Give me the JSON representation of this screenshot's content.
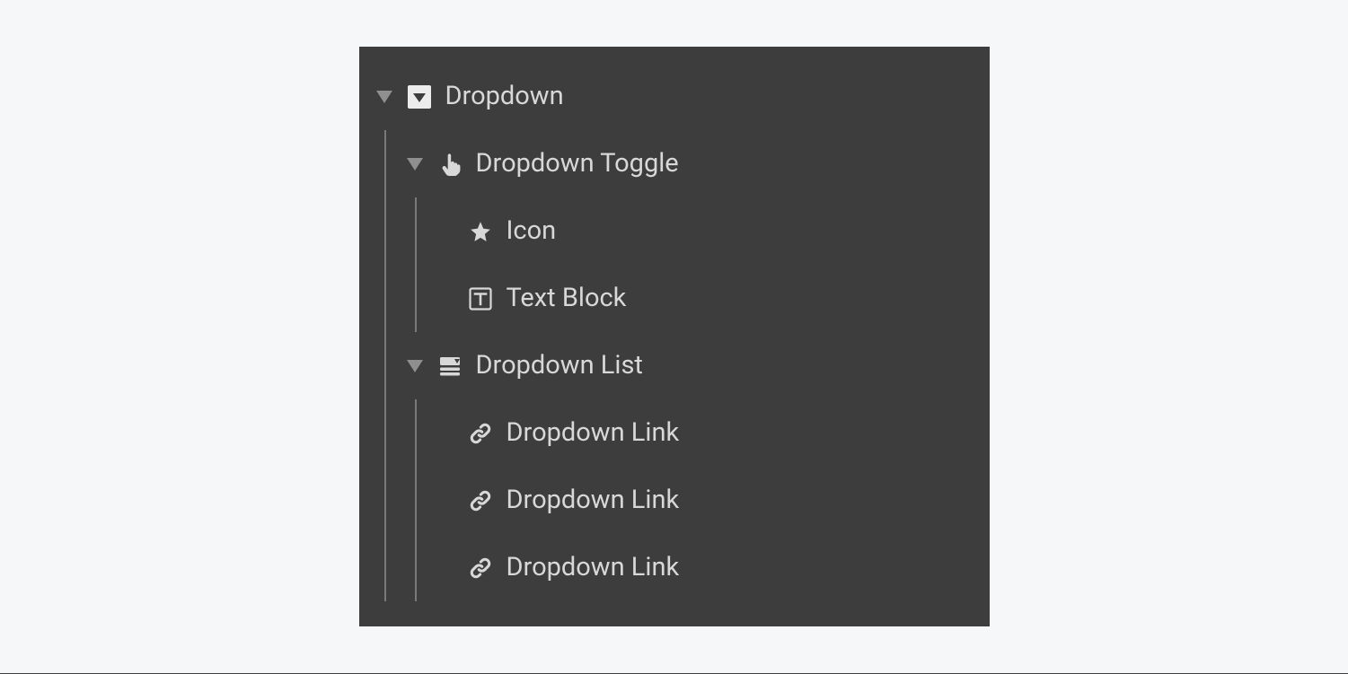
{
  "tree": {
    "root": {
      "label": "Dropdown",
      "expanded": true,
      "children": {
        "toggle": {
          "label": "Dropdown Toggle",
          "expanded": true,
          "children": {
            "icon": {
              "label": "Icon"
            },
            "textblock": {
              "label": "Text Block"
            }
          }
        },
        "list": {
          "label": "Dropdown List",
          "expanded": true,
          "children": {
            "link1": {
              "label": "Dropdown Link"
            },
            "link2": {
              "label": "Dropdown Link"
            },
            "link3": {
              "label": "Dropdown Link"
            }
          }
        }
      }
    }
  }
}
